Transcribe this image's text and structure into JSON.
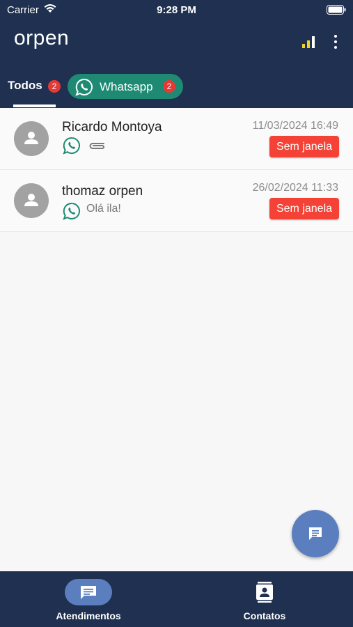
{
  "status_bar": {
    "carrier": "Carrier",
    "time": "9:28 PM"
  },
  "header": {
    "logo": "orpen"
  },
  "tabs": {
    "todos": {
      "label": "Todos",
      "count": "2"
    },
    "whatsapp": {
      "label": "Whatsapp",
      "count": "2"
    }
  },
  "conversations": [
    {
      "name": "Ricardo Montoya",
      "timestamp": "11/03/2024 16:49",
      "status": "Sem janela",
      "preview": "",
      "channel_icon": "whatsapp-icon",
      "attachment_icon": "paperclip-icon"
    },
    {
      "name": "thomaz orpen",
      "timestamp": "26/02/2024 11:33",
      "status": "Sem janela",
      "preview": "Olá ila!",
      "channel_icon": "whatsapp-icon"
    }
  ],
  "bottom_nav": {
    "atendimentos": "Atendimentos",
    "contatos": "Contatos"
  },
  "colors": {
    "header_bg": "#1f3050",
    "whatsapp_green": "#1e8a73",
    "badge_red": "#e53935",
    "status_red": "#f44336",
    "accent_blue": "#5b7fbe",
    "signal_yellow": "#f2d22b"
  }
}
